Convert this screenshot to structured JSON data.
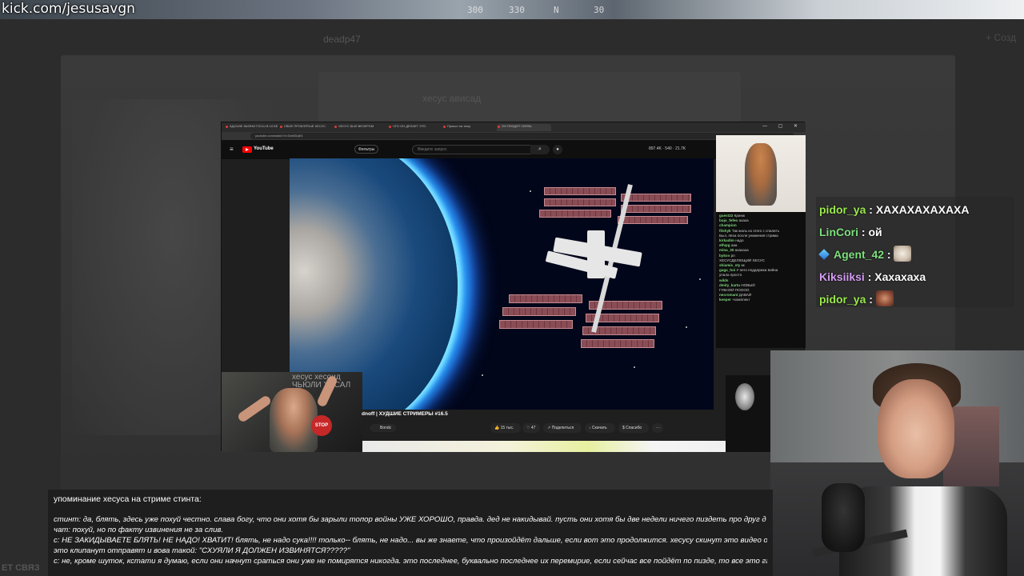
{
  "stream": {
    "url": "kick.com/jesusavgn"
  },
  "hud": {
    "values": [
      "300",
      "330",
      "N",
      "30"
    ]
  },
  "background_app": {
    "title": "deadp47",
    "ghost_text": "хесус ависад",
    "add_label": "+ Созд",
    "footer": "ЕТ СВЯЗ"
  },
  "browser": {
    "tabs": [
      "АДСКИЕ ЖИЗНИ ГОСЫ В 10 БЕ",
      "СВОЕ ПРОКЛЯТЫЕ ХЕСУС",
      "ХЕСУС БЫЛ ВЕЧЕРОМ",
      "ЧТО ОН ДЕЛАЕТ ЭТО",
      "Прикол на тему",
      "ОН ПИЗДИТ СВЯЗЬ"
    ],
    "url": "youtube.com/watch?v=DnMDqE4",
    "window_buttons": "— ▢ ✕"
  },
  "youtube": {
    "logo_text": "YouTube",
    "filters_label": "Фильтры",
    "search_placeholder": "Введите запрос",
    "stats": "897.4K  ·  540  ·  21.7K",
    "video_title": "dnoff | ХУДШИЕ СТРИМЕРЫ #16.5",
    "channel": "Bondc",
    "actions": {
      "likes": "15 тыс.",
      "dislikes": "47",
      "share": "Поделиться",
      "download": "Скачать",
      "save": "Спасибо",
      "more": "···"
    }
  },
  "webcam_overlay": {
    "text_top": "хесус хесоид",
    "text_bottom": "ЧЬЮЛИ ХЕСАЛ",
    "stop_sign": "STOP"
  },
  "mini_chat": [
    {
      "user": "guest22",
      "text": "Кринж"
    },
    {
      "user": "bojo_fefeo",
      "text": "ахаха"
    },
    {
      "user": "champion",
      "text": ""
    },
    {
      "user": "filshyk",
      "text": "Так жаль из этого с спалить"
    },
    {
      "user": "",
      "text": "Был, пёха после унижения стрима"
    },
    {
      "user": "kirkadim",
      "text": "надо"
    },
    {
      "user": "elfvpg",
      "text": "ааа"
    },
    {
      "user": "mina_30",
      "text": "ахахаха"
    },
    {
      "user": "bykov",
      "text": "рп"
    },
    {
      "user": "",
      "text": "ХЕСУСДЕЛЮЩИЙ ХЕСУС"
    },
    {
      "user": "shiamis_sty",
      "text": "кк"
    },
    {
      "user": "gaga_hoi",
      "text": "У него поддержка война"
    },
    {
      "user": "",
      "text": "упала просто"
    },
    {
      "user": "wilds",
      "text": ""
    },
    {
      "user": "dmity_kartu",
      "text": "НОВЫЙ"
    },
    {
      "user": "",
      "text": "ГУБНОЙ ПОООО"
    },
    {
      "user": "necromant",
      "text": "ДАВАЙ"
    },
    {
      "user": "keeper",
      "text": "+комплект"
    }
  ],
  "chat": [
    {
      "user": "pidor_ya",
      "text": "ХАХАХАХАХАХА",
      "emote": ""
    },
    {
      "user": "LinCori",
      "text": "ой",
      "emote": ""
    },
    {
      "user": "Agent_42",
      "text": "",
      "emote": "cat"
    },
    {
      "user": "Kiksiiksi",
      "text": "Хахахаха",
      "emote": ""
    },
    {
      "user": "pidor_ya",
      "text": "",
      "emote": "face"
    }
  ],
  "chat_separator": " : ",
  "caption": {
    "title": "упоминание хесуса на стриме стинта:",
    "lines": [
      "стинт: да, блять, здесь уже похуй честно. слава богу, что они хотя бы зарыли топор войны УЖЕ ХОРОШО, правда. дед не накидывай. пусть они хотя бы две недели ничего пиздеть про друг д",
      "чат: похуй, но по факту извинения не за слив.",
      "с: НЕ ЗАКИДЫВАЕТЕ БЛЯТЬ! НЕ НАДО! ХВАТИТ! блять, не надо сука!!!! только-- блять, не надо... вы же знаете, что произойдёт дальше, если вот это продолжится. хесусу скинут это видео он ска",
      "это клипанут отправят и вова такой: \"СХУЯЛИ Я ДОЛЖЕН ИЗВИНЯТСЯ?????\"",
      "с: не, кроме шуток, кстати я думаю, если они начнут сраться они уже не помирятся никогда. это последнее, буквально последнее их перемирие, если сейчас все пойдёт по пизде, то все это гг"
    ]
  }
}
